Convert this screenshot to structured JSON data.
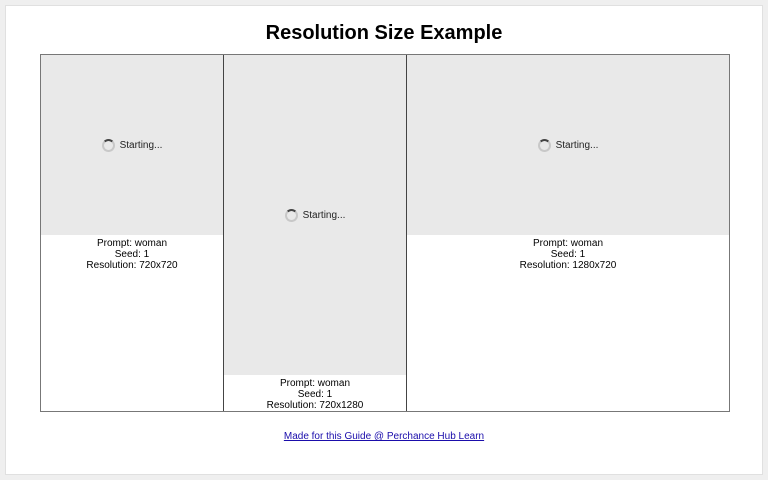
{
  "page": {
    "title": "Resolution Size Example"
  },
  "cards": [
    {
      "status": "Starting...",
      "prompt": "Prompt: woman",
      "seed": "Seed: 1",
      "resolution": "Resolution: 720x720"
    },
    {
      "status": "Starting...",
      "prompt": "Prompt: woman",
      "seed": "Seed: 1",
      "resolution": "Resolution: 720x1280"
    },
    {
      "status": "Starting...",
      "prompt": "Prompt: woman",
      "seed": "Seed: 1",
      "resolution": "Resolution: 1280x720"
    }
  ],
  "footer": {
    "link_text": "Made for this Guide @ Perchance Hub Learn"
  },
  "icons": {
    "loader": "loading-spinner-icon"
  }
}
